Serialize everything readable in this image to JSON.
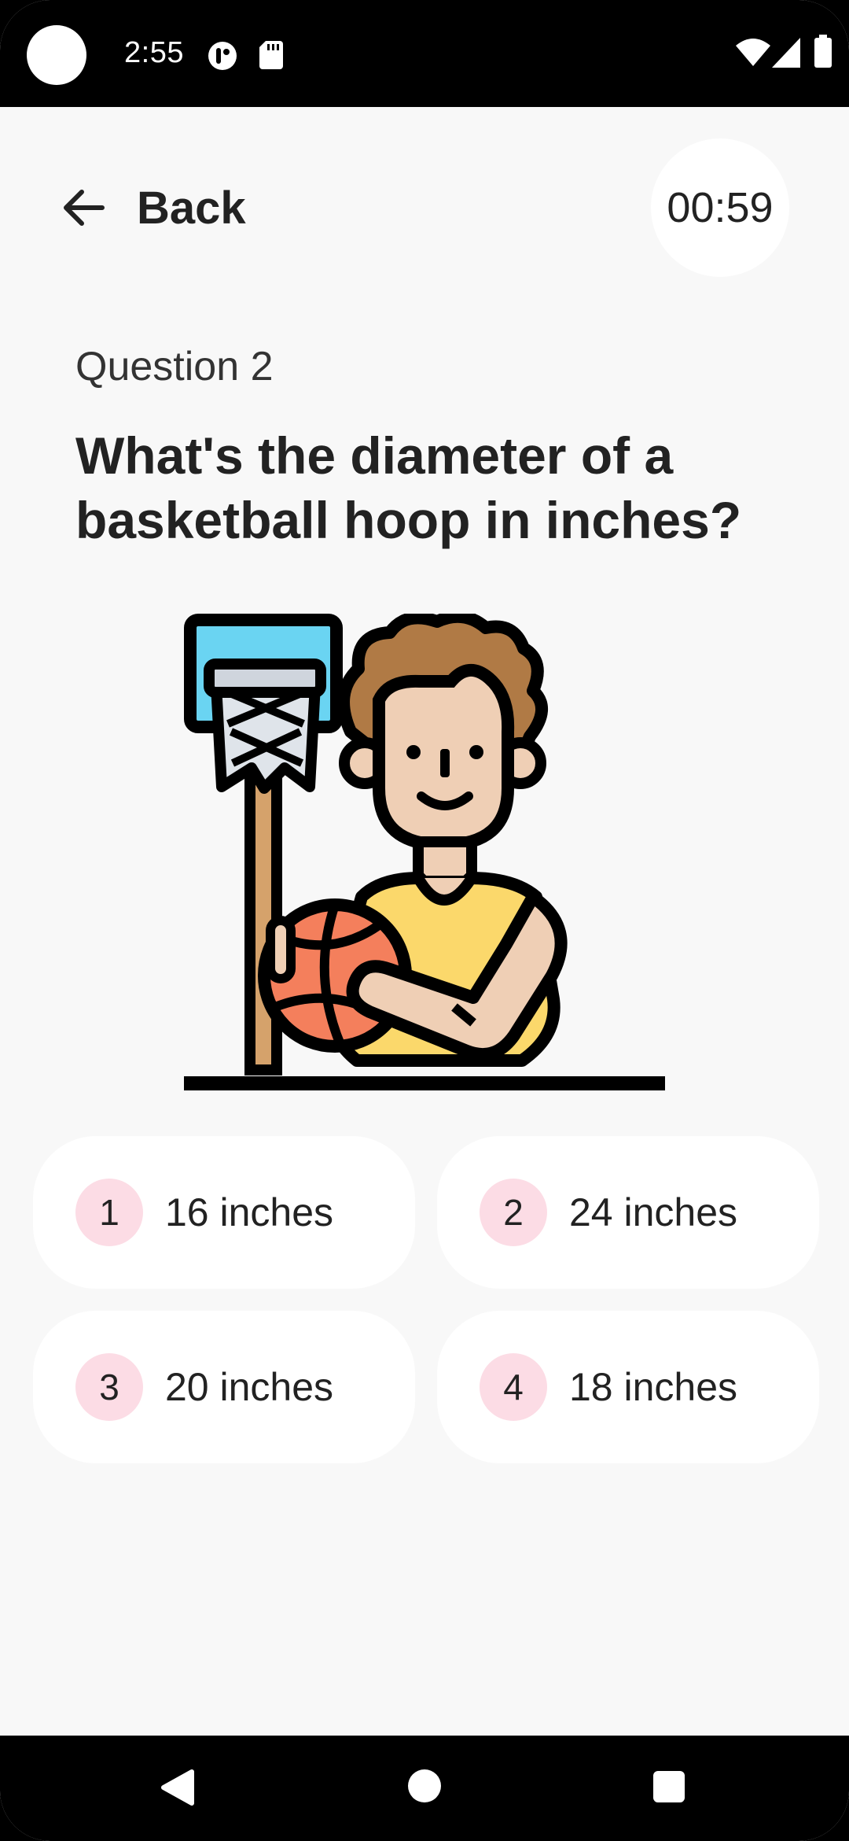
{
  "status_bar": {
    "time": "2:55"
  },
  "header": {
    "back_label": "Back",
    "timer": "00:59"
  },
  "question": {
    "number_label": "Question 2",
    "text": "What's the diameter of a basketball hoop in inches?"
  },
  "options": [
    {
      "badge": "1",
      "label": "16 inches"
    },
    {
      "badge": "2",
      "label": "24 inches"
    },
    {
      "badge": "3",
      "label": "20 inches"
    },
    {
      "badge": "4",
      "label": "18 inches"
    }
  ],
  "colors": {
    "background": "#f8f8f8",
    "card": "#ffffff",
    "badge": "#fcdce5",
    "text": "#222222"
  },
  "icons": {
    "back": "arrow-left-icon",
    "nav_back": "triangle-back-icon",
    "nav_home": "circle-home-icon",
    "nav_recents": "square-recents-icon"
  }
}
